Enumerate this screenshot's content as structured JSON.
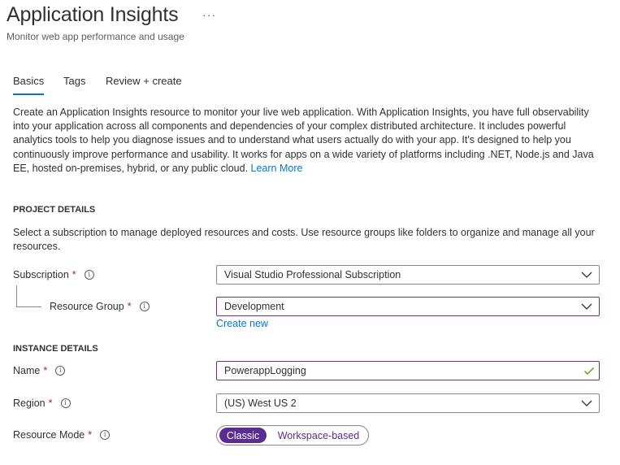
{
  "header": {
    "title": "Application Insights",
    "more": "···",
    "subtitle": "Monitor web app performance and usage"
  },
  "tabs": [
    {
      "label": "Basics",
      "active": true
    },
    {
      "label": "Tags",
      "active": false
    },
    {
      "label": "Review + create",
      "active": false
    }
  ],
  "intro": {
    "text": "Create an Application Insights resource to monitor your live web application. With Application Insights, you have full observability into your application across all components and dependencies of your complex distributed architecture. It includes powerful analytics tools to help you diagnose issues and to understand what users actually do with your app. It's designed to help you continuously improve performance and usability. It works for apps on a wide variety of platforms including .NET, Node.js and Java EE, hosted on-premises, hybrid, or any public cloud.",
    "link": "Learn More"
  },
  "project": {
    "heading": "PROJECT DETAILS",
    "description": "Select a subscription to manage deployed resources and costs. Use resource groups like folders to organize and manage all your resources.",
    "subscription_label": "Subscription",
    "subscription_value": "Visual Studio Professional Subscription",
    "resource_group_label": "Resource Group",
    "resource_group_value": "Development",
    "create_new": "Create new"
  },
  "instance": {
    "heading": "INSTANCE DETAILS",
    "name_label": "Name",
    "name_value": "PowerappLogging",
    "region_label": "Region",
    "region_value": "(US) West US 2",
    "mode_label": "Resource Mode",
    "mode_options": [
      "Classic",
      "Workspace-based"
    ],
    "mode_selected": "Classic"
  },
  "common": {
    "required": "*",
    "info": "i"
  },
  "colors": {
    "accent": "#0078d4",
    "purple": "#5c2d91",
    "valid_check": "#57a300",
    "required": "#a4262c"
  }
}
